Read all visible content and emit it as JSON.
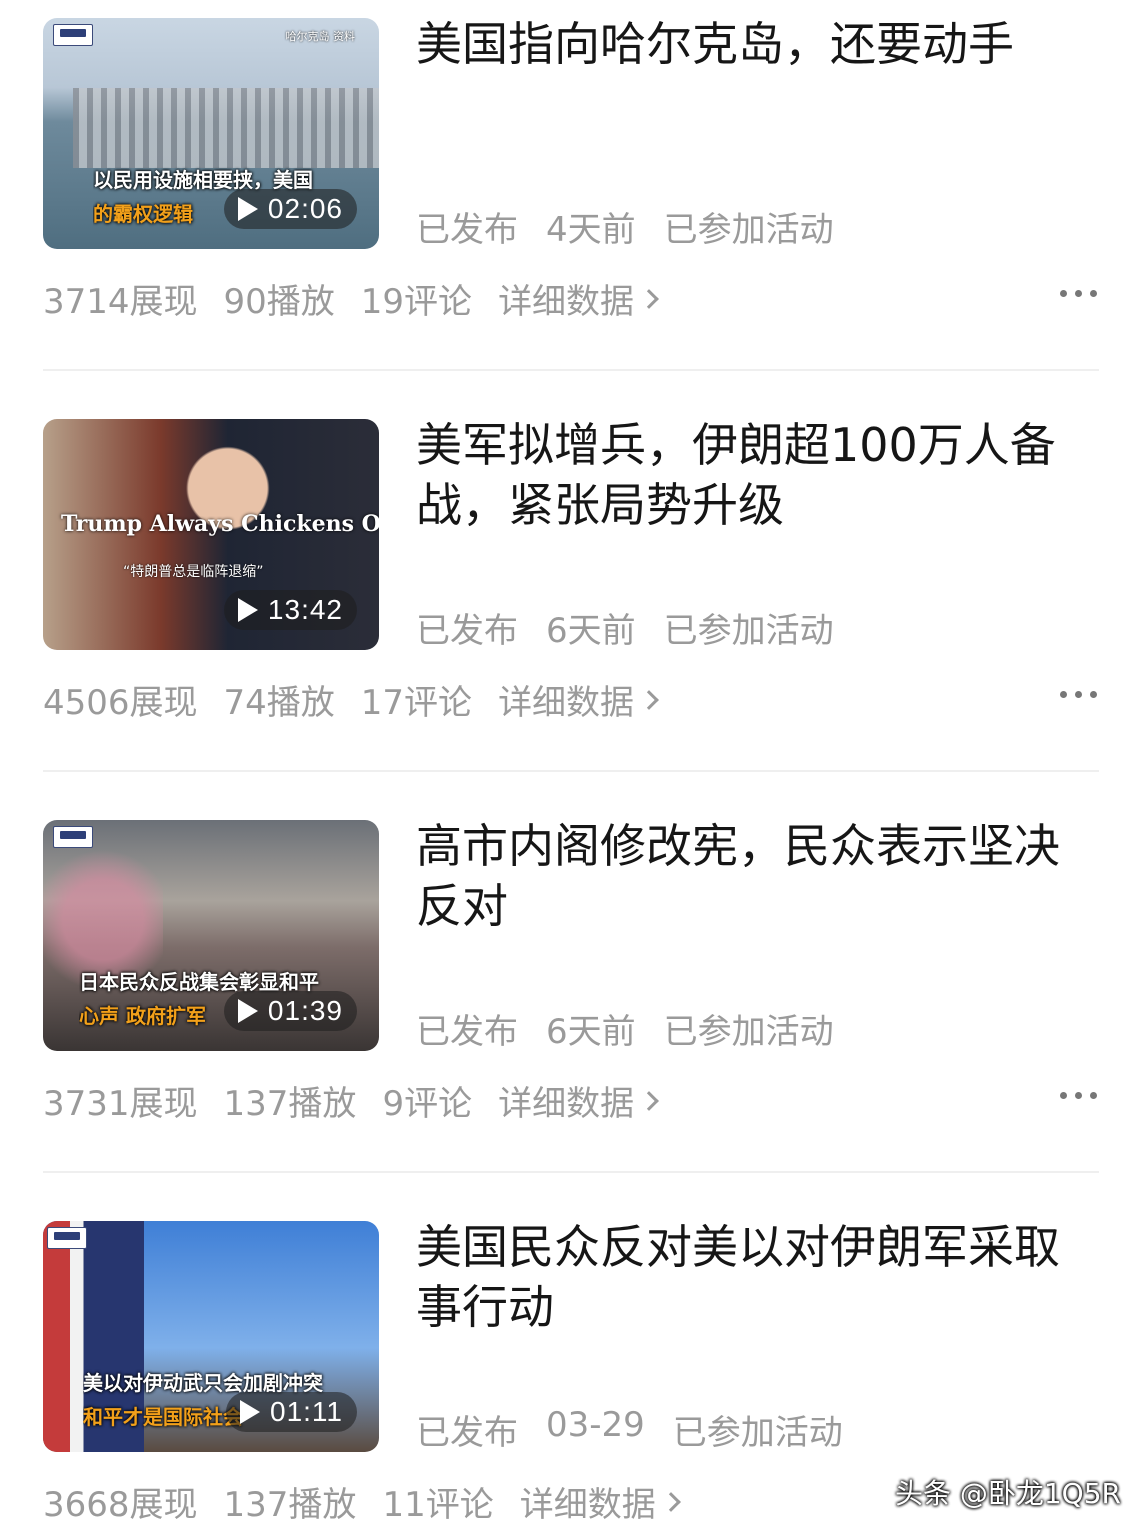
{
  "items": [
    {
      "title": "美国指向哈尔克岛，还要动手",
      "duration": "02:06",
      "thumb_caption_1": "以民用设施相要挟，美国",
      "thumb_caption_2": "的霸权逻辑",
      "thumb_source": "哈尔克岛 资料",
      "status": "已发布",
      "time": "4天前",
      "activity": "已参加活动",
      "impressions": "3714展现",
      "plays": "90播放",
      "comments": "19评论",
      "detail": "详细数据"
    },
    {
      "title": "美军拟增兵，伊朗超100万人备战，紧张局势升级",
      "duration": "13:42",
      "thumb_caption_1": "Trump Always Chickens Out",
      "thumb_caption_2": "“特朗普总是临阵退缩”",
      "status": "已发布",
      "time": "6天前",
      "activity": "已参加活动",
      "impressions": "4506展现",
      "plays": "74播放",
      "comments": "17评论",
      "detail": "详细数据"
    },
    {
      "title": "高市内阁修改宪，民众表示坚决反对",
      "duration": "01:39",
      "thumb_caption_1": "日本民众反战集会彰显和平",
      "thumb_caption_2": "心声 政府扩军",
      "status": "已发布",
      "time": "6天前",
      "activity": "已参加活动",
      "impressions": "3731展现",
      "plays": "137播放",
      "comments": "9评论",
      "detail": "详细数据"
    },
    {
      "title": "美国民众反对美以对伊朗军采取事行动",
      "duration": "01:11",
      "thumb_caption_1": "美以对伊动武只会加剧冲突",
      "thumb_caption_2": "和平才是国际社会",
      "status": "已发布",
      "time": "03-29",
      "activity": "已参加活动",
      "impressions": "3668展现",
      "plays": "137播放",
      "comments": "11评论",
      "detail": "详细数据"
    }
  ],
  "watermark": "头条 @卧龙1Q5R"
}
